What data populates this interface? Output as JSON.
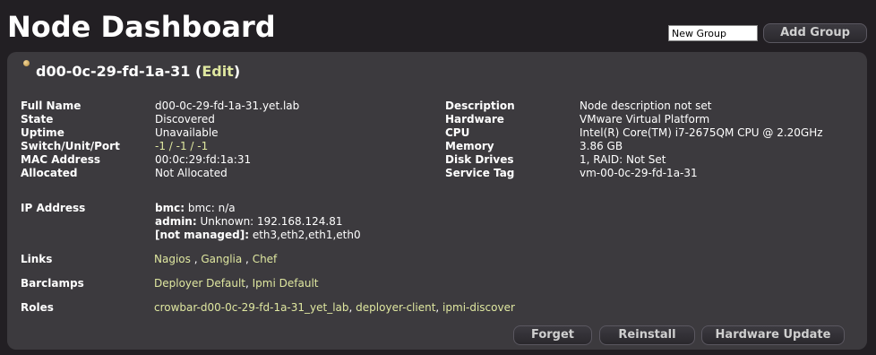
{
  "header": {
    "title": "Node Dashboard",
    "group_input_value": "New Group",
    "add_group_label": "Add Group"
  },
  "node": {
    "name": "d00-0c-29-fd-1a-31",
    "edit_label": "Edit",
    "status_color": "#e8c06a"
  },
  "labels": {
    "full_name": "Full Name",
    "state": "State",
    "uptime": "Uptime",
    "switch": "Switch/Unit/Port",
    "mac": "MAC Address",
    "allocated": "Allocated",
    "description": "Description",
    "hardware": "Hardware",
    "cpu": "CPU",
    "memory": "Memory",
    "disk_drives": "Disk Drives",
    "service_tag": "Service Tag",
    "ip_address": "IP Address",
    "links": "Links",
    "barclamps": "Barclamps",
    "roles": "Roles"
  },
  "values": {
    "full_name": "d00-0c-29-fd-1a-31.yet.lab",
    "state": "Discovered",
    "uptime": "Unavailable",
    "switch": "-1 / -1 / -1",
    "mac": "00:0c:29:fd:1a:31",
    "allocated": "Not Allocated",
    "description": "Node description not set",
    "hardware": "VMware Virtual Platform",
    "cpu": "Intel(R) Core(TM) i7-2675QM CPU @ 2.20GHz",
    "memory": "3.86 GB",
    "disk_drives": "1, RAID: Not Set",
    "service_tag": "vm-00-0c-29-fd-1a-31"
  },
  "ip": {
    "bmc_key": "bmc:",
    "bmc_val": " bmc: n/a",
    "admin_key": "admin:",
    "admin_val": " Unknown: 192.168.124.81",
    "unmanaged_key": "[not managed]:",
    "unmanaged_val": " eth3,eth2,eth1,eth0"
  },
  "links": {
    "nagios": "Nagios",
    "ganglia": "Ganglia",
    "chef": "Chef",
    "sep": " , "
  },
  "barclamps": {
    "deployer": "Deployer Default",
    "ipmi": "Ipmi Default",
    "sep": ", "
  },
  "roles": {
    "role1": "crowbar-d00-0c-29-fd-1a-31_yet_lab",
    "role2": "deployer-client",
    "role3": "ipmi-discover",
    "sep": ", "
  },
  "actions": {
    "forget": "Forget",
    "reinstall": "Reinstall",
    "hardware_update": "Hardware Update"
  },
  "colors": {
    "background": "#221f23",
    "panel": "#3c3a3e",
    "link": "#dfe7a0"
  }
}
